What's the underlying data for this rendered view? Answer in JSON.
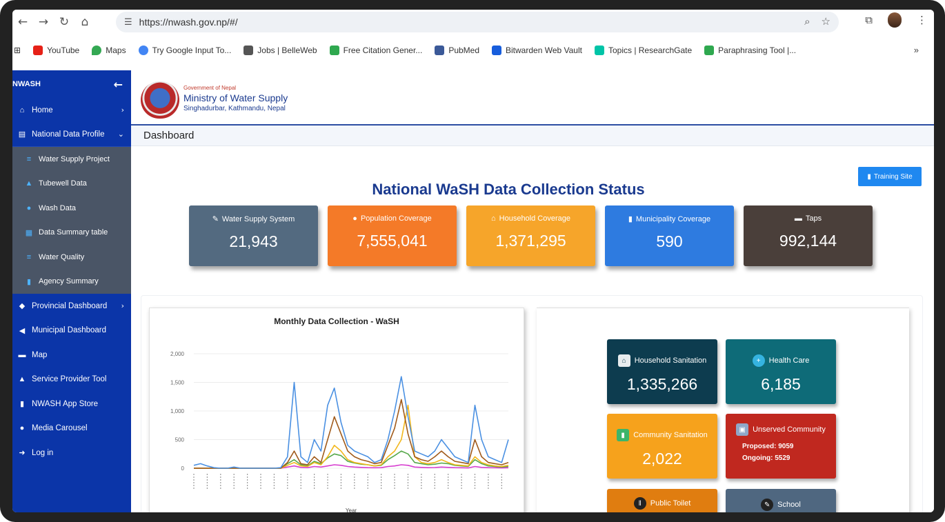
{
  "browser": {
    "url": "https://nwash.gov.np/#/",
    "bookmarks": [
      {
        "label": "YouTube",
        "color": "#e62117"
      },
      {
        "label": "Maps",
        "color": "#34a853"
      },
      {
        "label": "Try Google Input To...",
        "color": "#4285f4"
      },
      {
        "label": "Jobs | BelleWeb",
        "color": "#555555"
      },
      {
        "label": "Free Citation Gener...",
        "color": "#2fa84f"
      },
      {
        "label": "PubMed",
        "color": "#3b5998"
      },
      {
        "label": "Bitwarden Web Vault",
        "color": "#175ddc"
      },
      {
        "label": "Topics | ResearchGate",
        "color": "#00c4a7"
      },
      {
        "label": "Paraphrasing Tool |...",
        "color": "#2fa84f"
      }
    ]
  },
  "sidebar": {
    "brand": "NWASH",
    "items": [
      {
        "label": "Home",
        "icon": "home-icon",
        "glyph": "⌂",
        "chev": "›"
      },
      {
        "label": "National Data Profile",
        "icon": "database-icon",
        "glyph": "▤",
        "chev": "⌄"
      }
    ],
    "sub_items": [
      {
        "label": "Water Supply Project",
        "glyph": "≡"
      },
      {
        "label": "Tubewell Data",
        "glyph": "▲"
      },
      {
        "label": "Wash Data",
        "glyph": "●"
      },
      {
        "label": "Data Summary table",
        "glyph": "▦"
      },
      {
        "label": "Water Quality",
        "glyph": "≡"
      },
      {
        "label": "Agency Summary",
        "glyph": "▮"
      }
    ],
    "items2": [
      {
        "label": "Provincial Dashboard",
        "glyph": "◆",
        "chev": "›"
      },
      {
        "label": "Municipal Dashboard",
        "glyph": "◀",
        "chev": ""
      },
      {
        "label": "Map",
        "glyph": "▬",
        "chev": ""
      },
      {
        "label": "Service Provider Tool",
        "glyph": "▲",
        "chev": ""
      },
      {
        "label": "NWASH App Store",
        "glyph": "▮",
        "chev": ""
      },
      {
        "label": "Media Carousel",
        "glyph": "●",
        "chev": ""
      },
      {
        "label": "Log in",
        "glyph": "➜",
        "chev": ""
      }
    ]
  },
  "header": {
    "gov": "Government of Nepal",
    "ministry": "Ministry of Water Supply",
    "address": "Singhadurbar, Kathmandu, Nepal"
  },
  "breadcrumb": "Dashboard",
  "training_label": "Training Site",
  "page_title": "National WaSH Data Collection Status",
  "stats": [
    {
      "label": "Water Supply System",
      "value": "21,943",
      "color": "#536a80",
      "glyph": "✎"
    },
    {
      "label": "Population Coverage",
      "value": "7,555,041",
      "color": "#f47a28",
      "glyph": "●"
    },
    {
      "label": "Household Coverage",
      "value": "1,371,295",
      "color": "#f6a52a",
      "glyph": "⌂"
    },
    {
      "label": "Municipality Coverage",
      "value": "590",
      "color": "#2e7be0",
      "glyph": "▮"
    },
    {
      "label": "Taps",
      "value": "992,144",
      "color": "#4a3f3a",
      "glyph": "▬"
    }
  ],
  "tiles": [
    {
      "label": "Household Sanitation",
      "value": "1,335,266",
      "color": "#0d3c4f"
    },
    {
      "label": "Health Care",
      "value": "6,185",
      "color": "#0e6b78"
    },
    {
      "label": "Community Sanitation",
      "value": "2,022",
      "color": "#f6a21c"
    },
    {
      "label": "Unserved Community",
      "proposed": "Proposed: 9059",
      "ongoing": "Ongoing: 5529",
      "color": "#c0281f"
    },
    {
      "label": "Public Toilet",
      "color": "#e07d10"
    },
    {
      "label": "School",
      "color": "#4f6780"
    }
  ],
  "chart_data": {
    "type": "line",
    "title": "Monthly Data Collection - WaSH",
    "xlabel": "Year",
    "ylabel": "",
    "yticks": [
      "2,000",
      "1,500",
      "1,000",
      "500",
      "0"
    ],
    "ylim": [
      0,
      2000
    ],
    "series": [
      {
        "color": "#4a90e2",
        "values": [
          50,
          80,
          40,
          10,
          0,
          0,
          20,
          0,
          0,
          0,
          0,
          0,
          0,
          10,
          200,
          1500,
          200,
          100,
          500,
          300,
          1100,
          1400,
          800,
          400,
          300,
          250,
          200,
          100,
          150,
          500,
          1000,
          1600,
          900,
          300,
          250,
          200,
          300,
          500,
          350,
          200,
          150,
          100,
          1100,
          500,
          200,
          150,
          100,
          500
        ]
      },
      {
        "color": "#a05a1a",
        "values": [
          0,
          0,
          0,
          0,
          0,
          0,
          0,
          0,
          0,
          0,
          0,
          0,
          0,
          0,
          100,
          300,
          80,
          60,
          200,
          100,
          500,
          900,
          600,
          300,
          200,
          150,
          120,
          80,
          100,
          400,
          700,
          1200,
          600,
          200,
          150,
          120,
          200,
          300,
          200,
          120,
          100,
          80,
          500,
          200,
          100,
          80,
          60,
          100
        ]
      },
      {
        "color": "#f2b71b",
        "values": [
          0,
          0,
          0,
          0,
          0,
          0,
          0,
          0,
          0,
          0,
          0,
          0,
          0,
          0,
          50,
          100,
          40,
          30,
          100,
          60,
          200,
          400,
          300,
          150,
          100,
          80,
          60,
          40,
          60,
          200,
          300,
          500,
          1100,
          200,
          100,
          80,
          100,
          150,
          100,
          60,
          50,
          40,
          200,
          100,
          60,
          40,
          30,
          50
        ]
      },
      {
        "color": "#56a84a",
        "values": [
          0,
          0,
          0,
          0,
          0,
          0,
          0,
          0,
          0,
          0,
          0,
          0,
          0,
          0,
          80,
          150,
          60,
          40,
          120,
          80,
          180,
          250,
          220,
          120,
          90,
          70,
          60,
          40,
          50,
          150,
          220,
          300,
          250,
          100,
          80,
          60,
          70,
          90,
          80,
          50,
          40,
          30,
          150,
          80,
          40,
          30,
          20,
          30
        ]
      },
      {
        "color": "#d63ccf",
        "values": [
          0,
          0,
          0,
          0,
          0,
          0,
          0,
          0,
          0,
          0,
          0,
          0,
          0,
          0,
          20,
          40,
          15,
          10,
          30,
          20,
          40,
          60,
          50,
          30,
          20,
          15,
          10,
          8,
          10,
          30,
          40,
          60,
          50,
          20,
          15,
          10,
          12,
          20,
          15,
          10,
          8,
          5,
          30,
          15,
          10,
          8,
          5,
          8
        ]
      }
    ]
  }
}
